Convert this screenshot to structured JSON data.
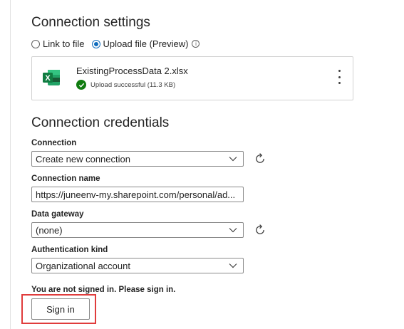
{
  "connection_settings": {
    "title": "Connection settings",
    "options": [
      {
        "label": "Link to file",
        "selected": false
      },
      {
        "label": "Upload file (Preview)",
        "selected": true
      }
    ],
    "file": {
      "name": "ExistingProcessData 2.xlsx",
      "status": "Upload successful (11.3 KB)",
      "icon": "excel-icon",
      "status_icon": "check-circle-icon"
    }
  },
  "connection_credentials": {
    "title": "Connection credentials",
    "connection": {
      "label": "Connection",
      "value": "Create new connection"
    },
    "connection_name": {
      "label": "Connection name",
      "value": "https://juneenv-my.sharepoint.com/personal/ad..."
    },
    "data_gateway": {
      "label": "Data gateway",
      "value": "(none)"
    },
    "auth_kind": {
      "label": "Authentication kind",
      "value": "Organizational account"
    }
  },
  "sign_in": {
    "message": "You are not signed in. Please sign in.",
    "button_label": "Sign in"
  },
  "colors": {
    "accent": "#0f6cbd",
    "success": "#107c10",
    "excel": "#107c41",
    "highlight": "#e03c3c"
  }
}
